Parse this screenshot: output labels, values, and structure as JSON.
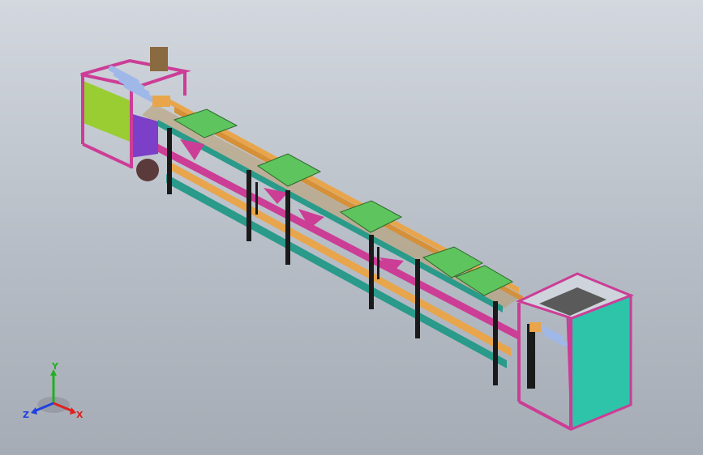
{
  "viewport": {
    "background_top": "#d3d8df",
    "background_bottom": "#a6acb5"
  },
  "model": {
    "parts": {
      "frame_color": "#cc3d96",
      "frame_dark": "#8a1f63",
      "panel_green": "#9acd32",
      "panel_teal": "#2ec4a9",
      "panel_purple": "#7b3fc8",
      "plate_green": "#5ec45e",
      "rail_orange": "#e8a54b",
      "rail_teal": "#2a9a8a",
      "leg_black": "#1a1a1a",
      "roller_blue": "#9fb8e8",
      "motor_dark": "#5a3a3a"
    }
  },
  "triad": {
    "x_label": "X",
    "y_label": "Y",
    "z_label": "Z",
    "x_color": "#e02020",
    "y_color": "#20b020",
    "z_color": "#2040e0"
  }
}
